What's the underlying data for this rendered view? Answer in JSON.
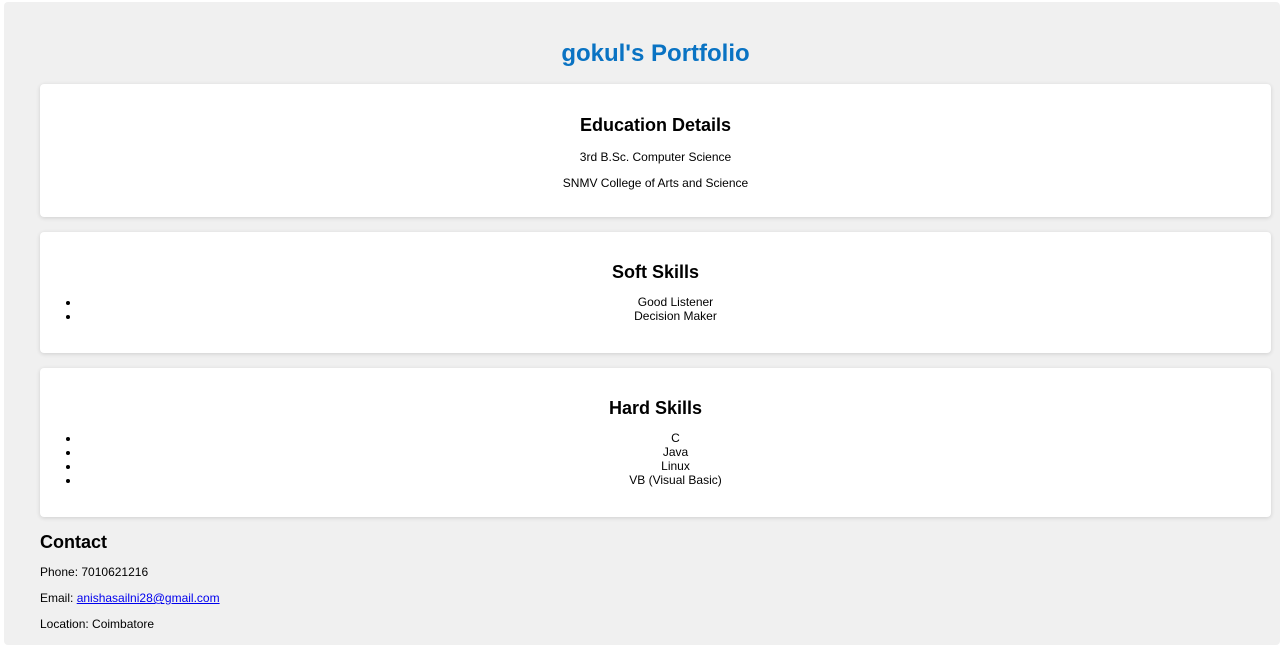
{
  "page": {
    "title": "gokul's Portfolio"
  },
  "education": {
    "heading": "Education Details",
    "degree": "3rd B.Sc. Computer Science",
    "college": "SNMV College of Arts and Science"
  },
  "soft_skills": {
    "heading": "Soft Skills",
    "items": [
      "Good Listener",
      "Decision Maker"
    ]
  },
  "hard_skills": {
    "heading": "Hard Skills",
    "items": [
      "C",
      "Java",
      "Linux",
      "VB (Visual Basic)"
    ]
  },
  "contact": {
    "heading": "Contact",
    "phone_label": "Phone: ",
    "phone": "7010621216",
    "email_label": "Email: ",
    "email": "anishasailni28@gmail.com",
    "location_label": "Location: ",
    "location": "Coimbatore"
  },
  "colors": {
    "title": "#0a73c3",
    "link": "#0000ee",
    "background": "#f0f0f0",
    "card": "#ffffff"
  }
}
